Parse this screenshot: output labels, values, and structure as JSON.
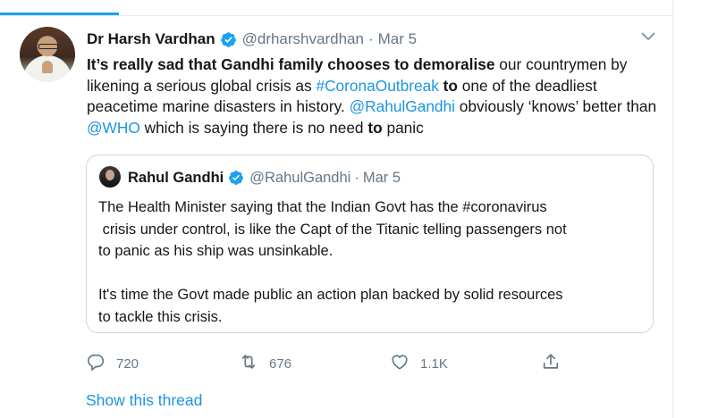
{
  "colors": {
    "link": "#1b95e0",
    "accent": "#1da1f2",
    "muted": "#657786",
    "text": "#14171a",
    "border": "#ccd6dd"
  },
  "tweet": {
    "author_name": "Dr Harsh Vardhan",
    "handle": "@drharshvardhan",
    "separator": "·",
    "date": "Mar 5",
    "text_runs": [
      {
        "text": "It’s really sad that Gandhi family chooses to demoralise",
        "style": "bold"
      },
      {
        "text": " our countrymen by likening a serious global crisis as ",
        "style": "normal"
      },
      {
        "text": "#CoronaOutbreak",
        "style": "link"
      },
      {
        "text": " ",
        "style": "normal"
      },
      {
        "text": "to",
        "style": "bold"
      },
      {
        "text": " one of the deadliest peacetime marine disasters in history. ",
        "style": "normal"
      },
      {
        "text": "@RahulGandhi",
        "style": "link"
      },
      {
        "text": " obviously ‘knows’ better than ",
        "style": "normal"
      },
      {
        "text": "@WHO",
        "style": "link"
      },
      {
        "text": " which is saying there is no need ",
        "style": "normal"
      },
      {
        "text": "to",
        "style": "bold"
      },
      {
        "text": " panic",
        "style": "normal"
      }
    ]
  },
  "quoted_tweet": {
    "author_name": "Rahul Gandhi",
    "handle": "@RahulGandhi",
    "separator": "·",
    "date": "Mar 5",
    "paragraph1_lines": [
      "The Health Minister saying that the Indian Govt has the #coronavirus",
      " crisis under control, is like the Capt of the Titanic telling passengers not",
      "to panic as his ship was unsinkable."
    ],
    "paragraph2_lines": [
      "It's time the Govt made public an action plan backed by solid resources",
      "to tackle this crisis."
    ]
  },
  "actions": {
    "reply_count": "720",
    "retweet_count": "676",
    "like_count": "1.1K",
    "reply_icon": "reply-icon",
    "retweet_icon": "retweet-icon",
    "like_icon": "heart-icon",
    "share_icon": "share-icon"
  },
  "show_thread_label": "Show this thread"
}
